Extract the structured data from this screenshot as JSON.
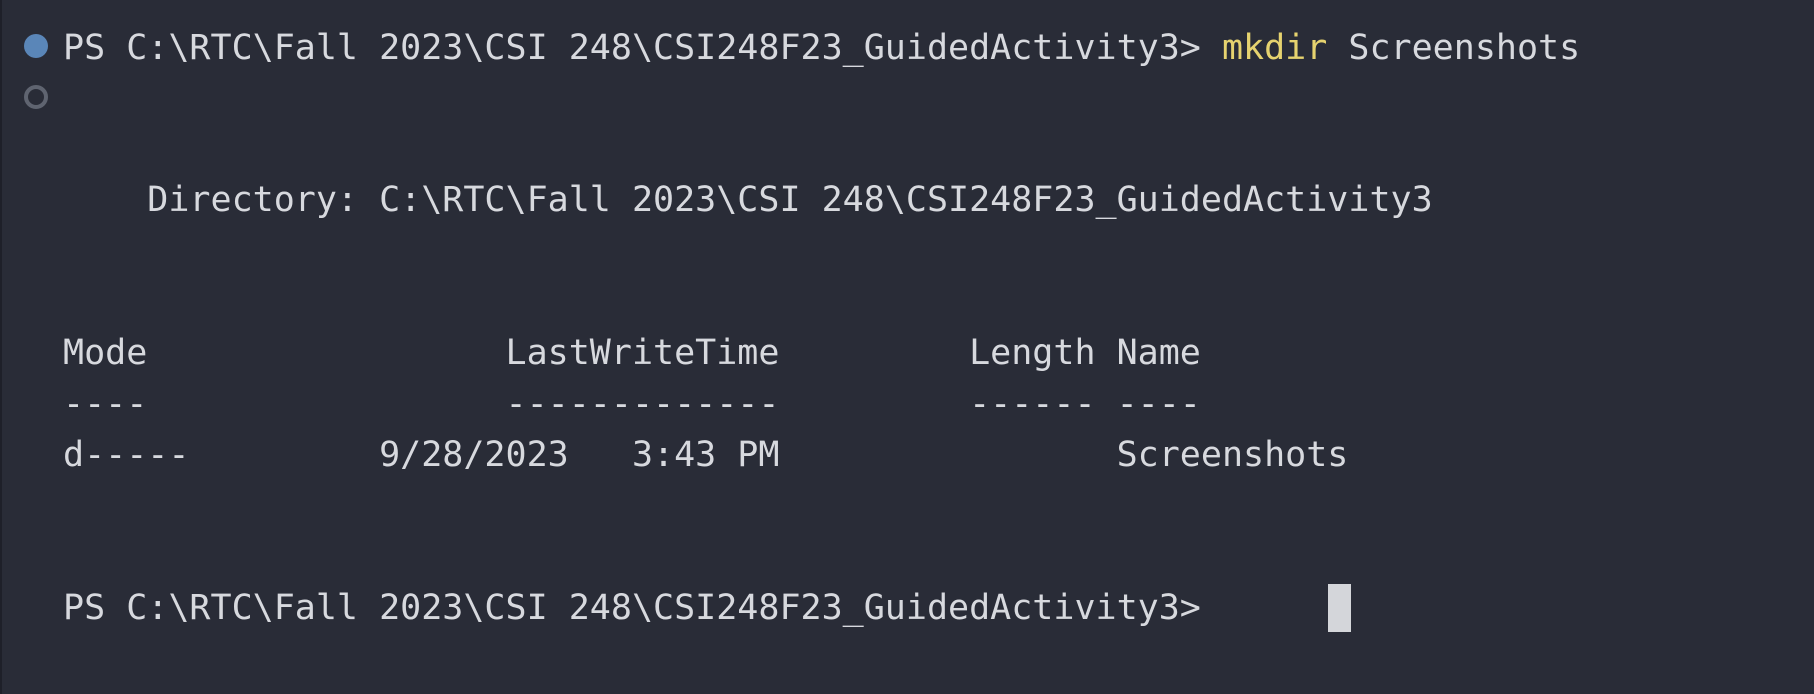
{
  "terminal": {
    "prompt_1": "PS C:\\RTC\\Fall 2023\\CSI 248\\CSI248F23_GuidedActivity3> ",
    "command": "mkdir",
    "command_arg": " Screenshots",
    "directory_line": "    Directory: C:\\RTC\\Fall 2023\\CSI 248\\CSI248F23_GuidedActivity3",
    "table_header": "Mode                 LastWriteTime         Length Name",
    "table_separator": "----                 -------------         ------ ----",
    "table_rows": [
      "d-----         9/28/2023   3:43 PM                Screenshots"
    ],
    "prompt_2": "PS C:\\RTC\\Fall 2023\\CSI 248\\CSI248F23_GuidedActivity3> "
  },
  "colors": {
    "background": "#292c37",
    "text": "#d7d9de",
    "command": "#e6d36f",
    "decoration_success": "#5a86b8",
    "decoration_empty": "#5f6470",
    "cursor": "#d4d6da"
  }
}
